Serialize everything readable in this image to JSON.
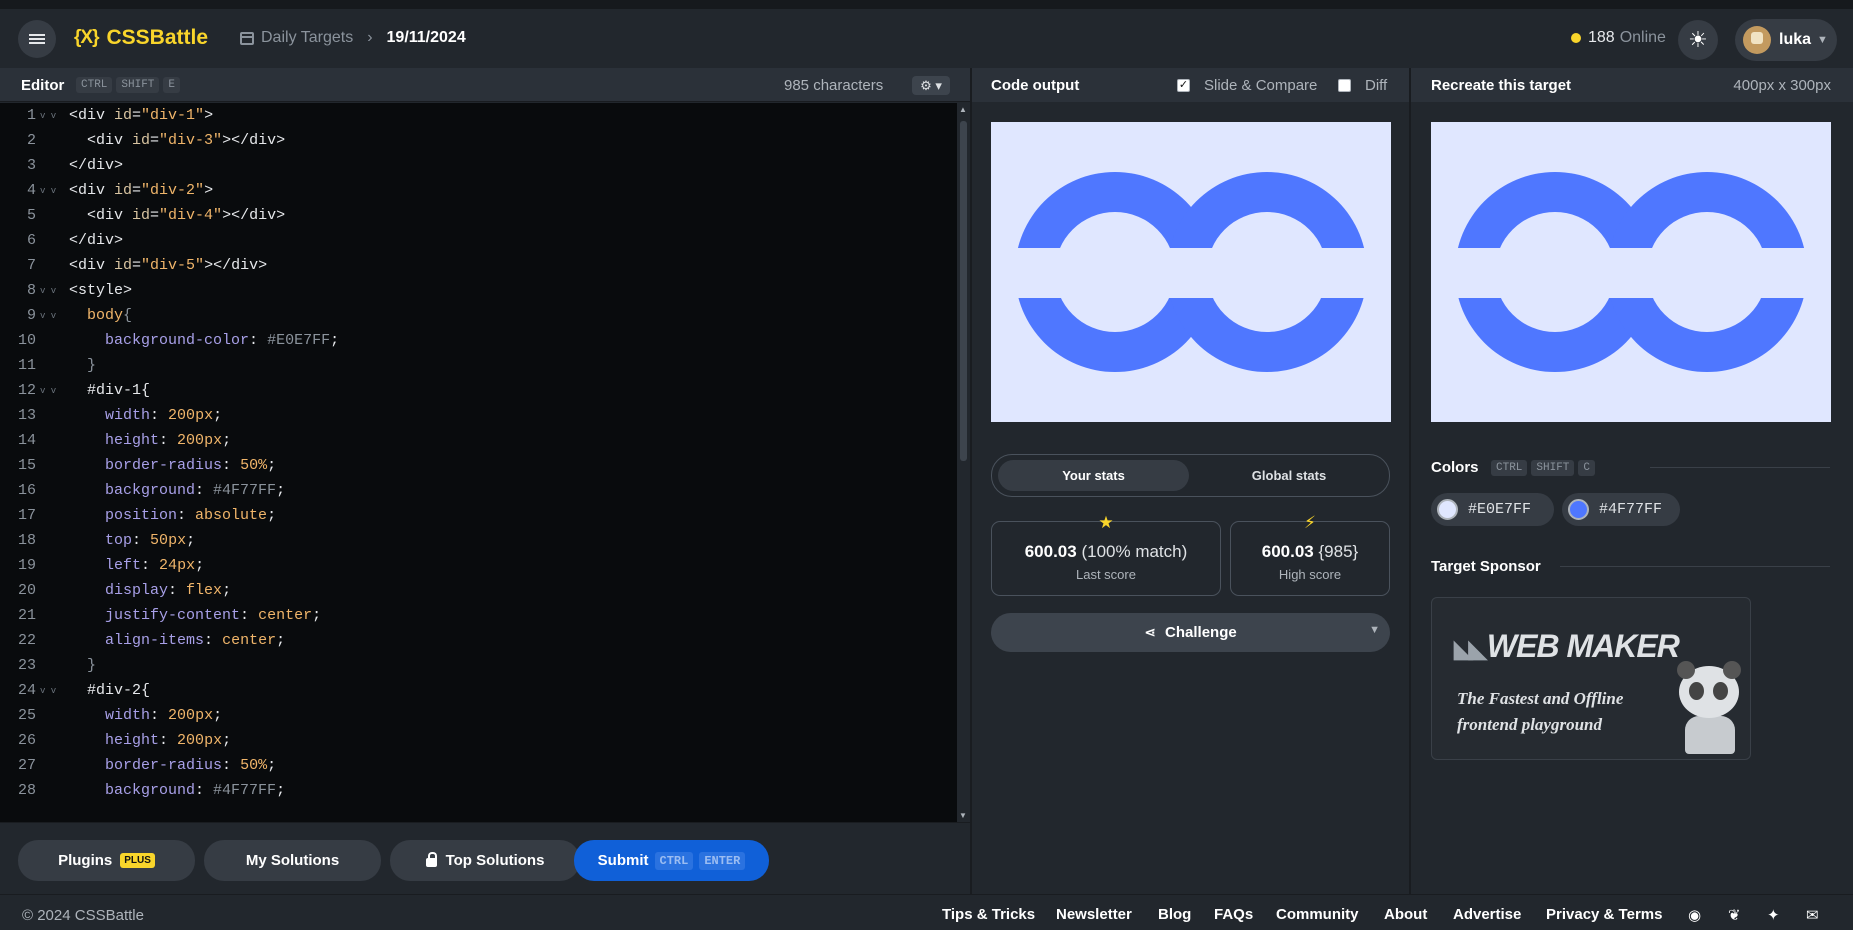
{
  "header": {
    "logo_mark": "{X}",
    "logo_text": "CSSBattle",
    "breadcrumb_parent": "Daily Targets",
    "breadcrumb_current": "19/11/2024",
    "online_count": "188",
    "online_label": "Online",
    "username": "luka"
  },
  "editor": {
    "title": "Editor",
    "shortcut": [
      "CTRL",
      "SHIFT",
      "E"
    ],
    "char_count": "985 characters",
    "lines": [
      "<div id=\"div-1\">",
      "  <div id=\"div-3\"></div>",
      "</div>",
      "<div id=\"div-2\">",
      "  <div id=\"div-4\"></div>",
      "</div>",
      "<div id=\"div-5\"></div>",
      "<style>",
      "  body{",
      "    background-color: #E0E7FF;",
      "  }",
      "  #div-1{",
      "    width: 200px;",
      "    height: 200px;",
      "    border-radius: 50%;",
      "    background: #4F77FF;",
      "    position: absolute;",
      "    top: 50px;",
      "    left: 24px;",
      "    display: flex;",
      "    justify-content: center;",
      "    align-items: center;",
      "  }",
      "  #div-2{",
      "    width: 200px;",
      "    height: 200px;",
      "    border-radius: 50%;",
      "    background: #4F77FF;"
    ],
    "folded_lines": [
      1,
      4,
      8,
      9,
      12,
      24
    ],
    "buttons": {
      "plugins": "Plugins",
      "plugins_badge": "PLUS",
      "my_solutions": "My Solutions",
      "top_solutions": "Top Solutions",
      "submit": "Submit",
      "submit_kbd": [
        "CTRL",
        "ENTER"
      ]
    }
  },
  "output": {
    "title": "Code output",
    "slide_compare_label": "Slide & Compare",
    "slide_compare_checked": true,
    "diff_label": "Diff",
    "diff_checked": false,
    "tabs": [
      "Your stats",
      "Global stats"
    ],
    "active_tab": "Your stats",
    "last_score": "600.03",
    "last_match": "(100% match)",
    "last_label": "Last score",
    "high_score": "600.03",
    "high_chars": "{985}",
    "high_label": "High score",
    "challenge_label": "Challenge"
  },
  "target": {
    "title": "Recreate this target",
    "size": "400px x 300px",
    "colors_title": "Colors",
    "colors_shortcut": [
      "CTRL",
      "SHIFT",
      "C"
    ],
    "colors": [
      "#E0E7FF",
      "#4F77FF"
    ],
    "sponsor_title": "Target Sponsor",
    "sponsor_name": "WEB MAKER",
    "sponsor_tagline": "The Fastest and Offline frontend playground"
  },
  "footer": {
    "copyright": "© 2024 CSSBattle",
    "links": [
      "Tips & Tricks",
      "Newsletter",
      "Blog",
      "FAQs",
      "Community",
      "About",
      "Advertise",
      "Privacy & Terms"
    ],
    "social_icons": [
      "discord-icon",
      "bluesky-icon",
      "twitter-icon",
      "mail-icon"
    ]
  },
  "colors": {
    "background": "#E0E7FF",
    "shape": "#4F77FF",
    "accent_yellow": "#f9d52b",
    "submit_blue": "#1060d8"
  }
}
